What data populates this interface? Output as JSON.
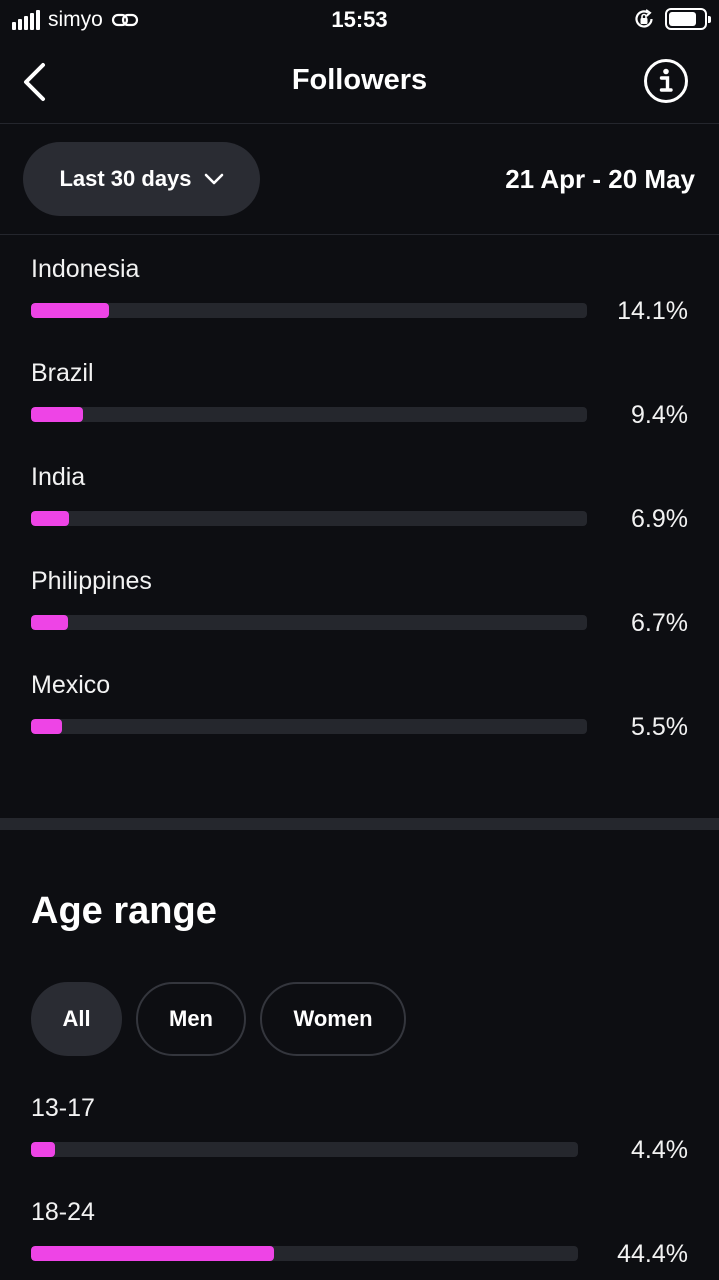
{
  "status_bar": {
    "carrier": "simyo",
    "time": "15:53"
  },
  "header": {
    "title": "Followers"
  },
  "period": {
    "selector_label": "Last 30 days",
    "date_range": "21 Apr - 20 May"
  },
  "countries": [
    {
      "name": "Indonesia",
      "value": "14.1%",
      "percent": 14.1
    },
    {
      "name": "Brazil",
      "value": "9.4%",
      "percent": 9.4
    },
    {
      "name": "India",
      "value": "6.9%",
      "percent": 6.9
    },
    {
      "name": "Philippines",
      "value": "6.7%",
      "percent": 6.7
    },
    {
      "name": "Mexico",
      "value": "5.5%",
      "percent": 5.5
    }
  ],
  "age_range": {
    "title": "Age range",
    "filters": [
      "All",
      "Men",
      "Women"
    ],
    "selected_filter": "All",
    "items": [
      {
        "range": "13-17",
        "value": "4.4%",
        "percent": 4.4
      },
      {
        "range": "18-24",
        "value": "44.4%",
        "percent": 44.4
      }
    ]
  },
  "colors": {
    "background": "#0d0e12",
    "bar_fill": "#ee44e6",
    "bar_track": "#25272d",
    "pill": "#2a2c33"
  }
}
